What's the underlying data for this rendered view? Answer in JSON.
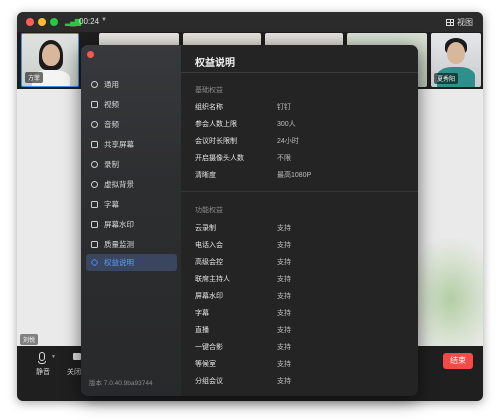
{
  "titlebar": {
    "timer": "00:24",
    "view_label": "视图"
  },
  "participants": [
    {
      "name": "方菲"
    },
    {
      "name": ""
    },
    {
      "name": ""
    },
    {
      "name": ""
    },
    {
      "name": ""
    },
    {
      "name": "夏秀阳"
    }
  ],
  "stage": {
    "cut_label": "刘悦"
  },
  "toolbar": {
    "mute_label": "静音",
    "camera_label": "关闭",
    "end_label": "结束"
  },
  "sidebar": {
    "items": [
      {
        "label": "通用",
        "icon": "gear-icon"
      },
      {
        "label": "视频",
        "icon": "video-icon"
      },
      {
        "label": "音频",
        "icon": "microphone-icon"
      },
      {
        "label": "共享屏幕",
        "icon": "share-screen-icon"
      },
      {
        "label": "录制",
        "icon": "record-icon"
      },
      {
        "label": "虚拟背景",
        "icon": "virtual-background-icon"
      },
      {
        "label": "字幕",
        "icon": "subtitle-icon"
      },
      {
        "label": "屏幕水印",
        "icon": "watermark-icon"
      },
      {
        "label": "质量监测",
        "icon": "quality-monitor-icon"
      },
      {
        "label": "权益说明",
        "icon": "diamond-icon"
      }
    ],
    "active_index": 9,
    "version": "版本 7.0.40.9ba93744"
  },
  "content": {
    "title": "权益说明",
    "basic_section": {
      "title": "基础权益",
      "rows": [
        {
          "key": "组织名称",
          "value": "钉钉"
        },
        {
          "key": "参会人数上限",
          "value": "300人"
        },
        {
          "key": "会议时长限制",
          "value": "24小时"
        },
        {
          "key": "开启摄像头人数",
          "value": "不限"
        },
        {
          "key": "清晰度",
          "value": "最高1080P"
        }
      ]
    },
    "feature_section": {
      "title": "功能权益",
      "rows": [
        {
          "key": "云录制",
          "value": "支持"
        },
        {
          "key": "电话入会",
          "value": "支持"
        },
        {
          "key": "高级会控",
          "value": "支持"
        },
        {
          "key": "联席主持人",
          "value": "支持"
        },
        {
          "key": "屏幕水印",
          "value": "支持"
        },
        {
          "key": "字幕",
          "value": "支持"
        },
        {
          "key": "直播",
          "value": "支持"
        },
        {
          "key": "一键合影",
          "value": "支持"
        },
        {
          "key": "等候室",
          "value": "支持"
        },
        {
          "key": "分组会议",
          "value": "支持"
        }
      ]
    }
  },
  "colors": {
    "accent": "#4c8ff8",
    "end_button": "#f54a45",
    "dialog_bg": "#242424"
  }
}
